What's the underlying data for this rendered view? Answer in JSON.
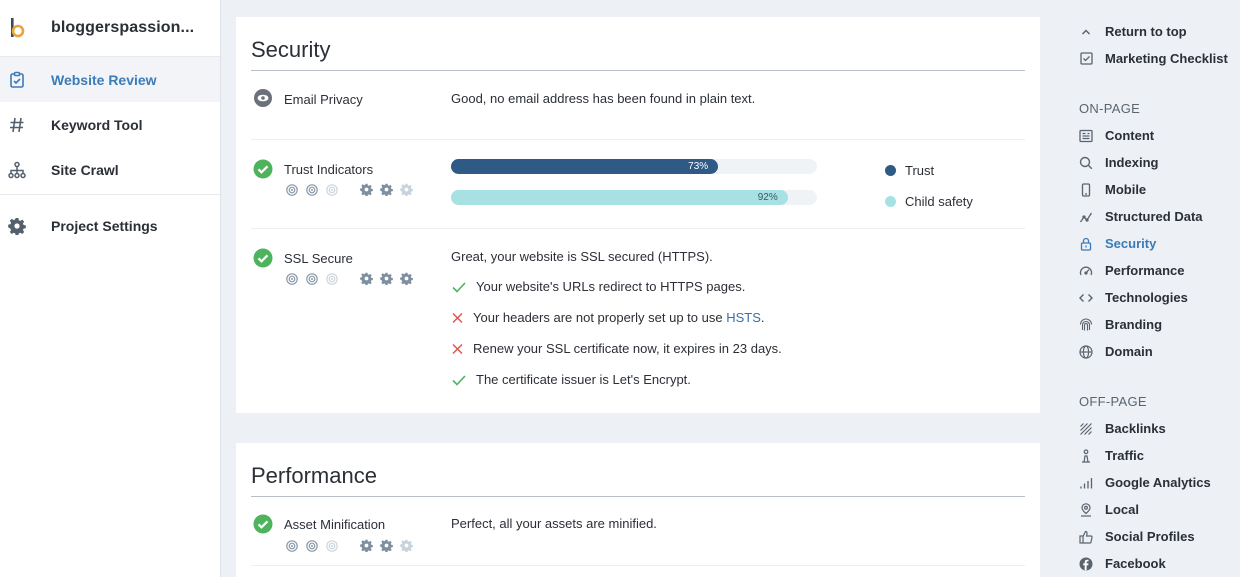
{
  "sidebar": {
    "project_name": "bloggerspassion...",
    "items": [
      {
        "label": "Website Review"
      },
      {
        "label": "Keyword Tool"
      },
      {
        "label": "Site Crawl"
      },
      {
        "label": "Project Settings"
      }
    ]
  },
  "security": {
    "title": "Security",
    "email_privacy": {
      "label": "Email Privacy",
      "text": "Good, no email address has been found in plain text."
    },
    "trust_indicators": {
      "label": "Trust Indicators",
      "bars": [
        {
          "name": "Trust",
          "value_label": "73%",
          "value": 73,
          "color": "#2f5a85"
        },
        {
          "name": "Child safety",
          "value_label": "92%",
          "value": 92,
          "color": "#a7e1e4"
        }
      ]
    },
    "ssl": {
      "label": "SSL Secure",
      "summary": "Great, your website is SSL secured (HTTPS).",
      "checks": [
        {
          "status": "pass",
          "text": "Your website's URLs redirect to HTTPS pages."
        },
        {
          "status": "fail",
          "text_before": "Your headers are not properly set up to use ",
          "link": "HSTS",
          "text_after": "."
        },
        {
          "status": "fail",
          "text": "Renew your SSL certificate now, it expires in 23 days."
        },
        {
          "status": "pass",
          "text": "The certificate issuer is Let's Encrypt."
        }
      ]
    }
  },
  "performance": {
    "title": "Performance",
    "asset_minification": {
      "label": "Asset Minification",
      "text": "Perfect, all your assets are minified."
    }
  },
  "rightnav": {
    "top": [
      {
        "label": "Return to top",
        "icon": "chevron-up-icon"
      },
      {
        "label": "Marketing Checklist",
        "icon": "checkbox-icon"
      }
    ],
    "on_page_heading": "ON-PAGE",
    "on_page": [
      {
        "label": "Content",
        "icon": "content-icon"
      },
      {
        "label": "Indexing",
        "icon": "search-icon"
      },
      {
        "label": "Mobile",
        "icon": "mobile-icon"
      },
      {
        "label": "Structured Data",
        "icon": "structured-data-icon"
      },
      {
        "label": "Security",
        "icon": "lock-icon",
        "active": true
      },
      {
        "label": "Performance",
        "icon": "speedometer-icon"
      },
      {
        "label": "Technologies",
        "icon": "code-icon"
      },
      {
        "label": "Branding",
        "icon": "fingerprint-icon"
      },
      {
        "label": "Domain",
        "icon": "globe-icon"
      }
    ],
    "off_page_heading": "OFF-PAGE",
    "off_page": [
      {
        "label": "Backlinks",
        "icon": "backlinks-icon"
      },
      {
        "label": "Traffic",
        "icon": "traffic-icon"
      },
      {
        "label": "Google Analytics",
        "icon": "analytics-icon"
      },
      {
        "label": "Local",
        "icon": "location-icon"
      },
      {
        "label": "Social Profiles",
        "icon": "thumbs-up-icon"
      },
      {
        "label": "Facebook",
        "icon": "facebook-icon"
      }
    ]
  }
}
